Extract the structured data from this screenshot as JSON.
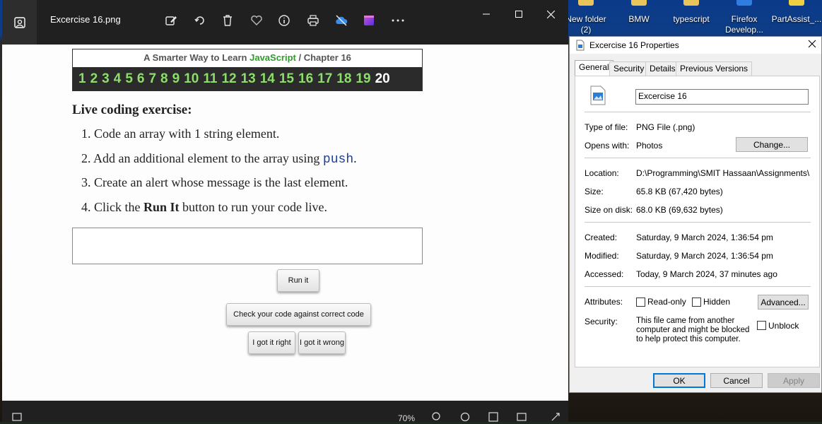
{
  "desktop": {
    "icons": [
      {
        "label": "New folder\n(2)",
        "color": "#e8c45a"
      },
      {
        "label": "BMW",
        "color": "#e8c45a"
      },
      {
        "label": "typescript",
        "color": "#e8c45a"
      },
      {
        "label": "Firefox\nDevelop...",
        "color": "#2f7de1"
      },
      {
        "label": "PartAssist_...",
        "color": "#f0d040"
      }
    ]
  },
  "photos": {
    "file_title": "Excercise 16.png",
    "toolbar_icons": [
      "edit-icon",
      "rotate-icon",
      "delete-icon",
      "favorite-icon",
      "info-icon",
      "print-icon",
      "cloud-off-icon",
      "clipchamp-icon",
      "more-icon"
    ],
    "zoom": "70%",
    "content": {
      "banner_prefix": "A Smarter Way to Learn ",
      "banner_js": "JavaScript",
      "banner_suffix": " / Chapter 16",
      "chapters": [
        "1",
        "2",
        "3",
        "4",
        "5",
        "6",
        "7",
        "8",
        "9",
        "10",
        "11",
        "12",
        "13",
        "14",
        "15",
        "16",
        "17",
        "18",
        "19",
        "20"
      ],
      "current_chapter": "20",
      "heading": "Live coding exercise:",
      "steps": [
        {
          "n": "1.",
          "text": "Code an array with 1 string element."
        },
        {
          "n": "2.",
          "text_before": "Add an additional element to the array using ",
          "code": "push",
          "text_after": "."
        },
        {
          "n": "3.",
          "text": "Create an alert whose message is the last element."
        },
        {
          "n": "4.",
          "text_before": "Click the ",
          "bold": "Run It",
          "text_after": " button to run your code live."
        }
      ],
      "run_button": "Run it",
      "check_button": "Check your code against correct code",
      "right_button": "I got it right",
      "wrong_button": "I got it wrong"
    }
  },
  "properties": {
    "title": "Excercise 16 Properties",
    "tabs": [
      "General",
      "Security",
      "Details",
      "Previous Versions"
    ],
    "file_name": "Excercise 16",
    "type_label": "Type of file:",
    "type_value": "PNG File (.png)",
    "opens_label": "Opens with:",
    "opens_value": "Photos",
    "change_button": "Change...",
    "location_label": "Location:",
    "location_value": "D:\\Programming\\SMIT Hassaan\\Assignments\\Exce",
    "size_label": "Size:",
    "size_value": "65.8 KB (67,420 bytes)",
    "disk_label": "Size on disk:",
    "disk_value": "68.0 KB (69,632 bytes)",
    "created_label": "Created:",
    "created_value": "Saturday, 9 March 2024, 1:36:54 pm",
    "modified_label": "Modified:",
    "modified_value": "Saturday, 9 March 2024, 1:36:54 pm",
    "accessed_label": "Accessed:",
    "accessed_value": "Today, 9 March 2024, 37 minutes ago",
    "attributes_label": "Attributes:",
    "readonly_label": "Read-only",
    "hidden_label": "Hidden",
    "advanced_button": "Advanced...",
    "security_label": "Security:",
    "security_text": "This file came from another computer and might be blocked to help protect this computer.",
    "unblock_label": "Unblock",
    "ok_button": "OK",
    "cancel_button": "Cancel",
    "apply_button": "Apply"
  }
}
